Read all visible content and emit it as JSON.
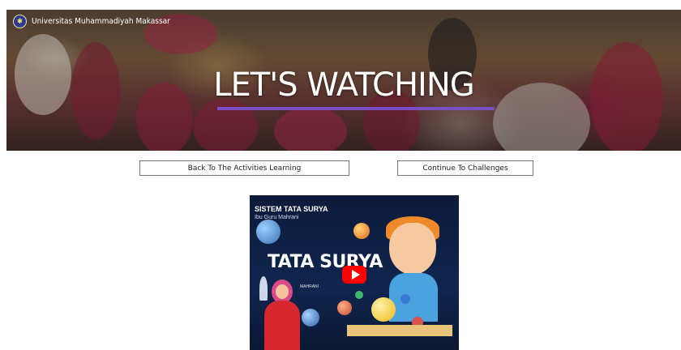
{
  "header": {
    "brand": "Universitas Muhammadiyah Makassar",
    "title": "LET'S WATCHING"
  },
  "actions": {
    "back_label": "Back To The Activities Learning",
    "continue_label": "Continue To Challenges"
  },
  "video": {
    "title": "SISTEM TATA SURYA",
    "subtitle": "Ibu Guru Mahrani",
    "big_title": "TATA SURYA",
    "name": "MAHRANI",
    "play_icon": "youtube-play-icon"
  },
  "colors": {
    "accent": "#7a4fc4",
    "play": "#ff0000"
  }
}
